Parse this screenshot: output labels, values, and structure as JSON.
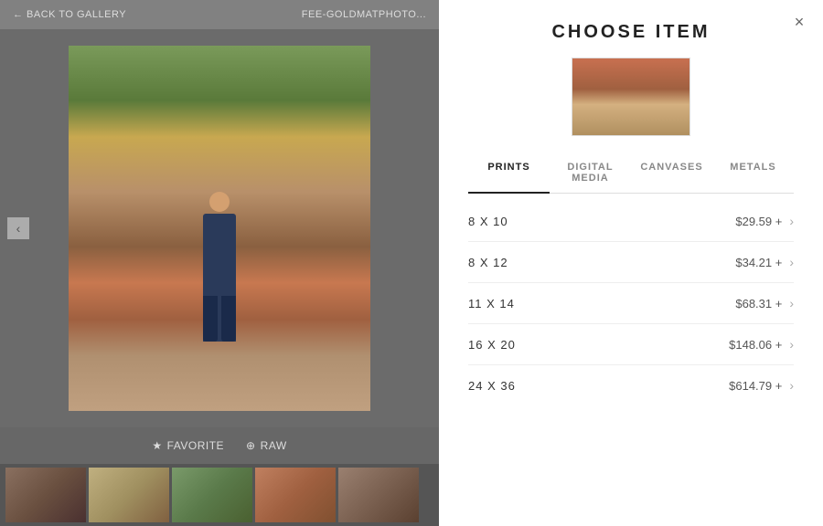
{
  "header": {
    "back_label": "← BACK TO GALLERY",
    "gallery_name": "FEE-GOLDMATPHOTO...",
    "close_label": "×"
  },
  "panel": {
    "title": "CHOOSE ITEM",
    "tabs": [
      {
        "id": "prints",
        "label": "PRINTS",
        "active": true
      },
      {
        "id": "digital",
        "label": "DIGITAL MEDIA",
        "active": false
      },
      {
        "id": "canvases",
        "label": "CANVASES",
        "active": false
      },
      {
        "id": "metals",
        "label": "METALS",
        "active": false
      }
    ],
    "prints": [
      {
        "size": "8 X 10",
        "price": "$29.59 +"
      },
      {
        "size": "8 X 12",
        "price": "$34.21 +"
      },
      {
        "size": "11 X 14",
        "price": "$68.31 +"
      },
      {
        "size": "16 X 20",
        "price": "$148.06 +"
      },
      {
        "size": "24 X 36",
        "price": "$614.79 +"
      }
    ]
  },
  "actions": {
    "favorite_label": "FAVORITE",
    "raw_label": "RAW"
  },
  "icons": {
    "arrow_left": "‹",
    "chevron_right": "›",
    "star": "★",
    "raw": "⊕",
    "close": "×"
  }
}
